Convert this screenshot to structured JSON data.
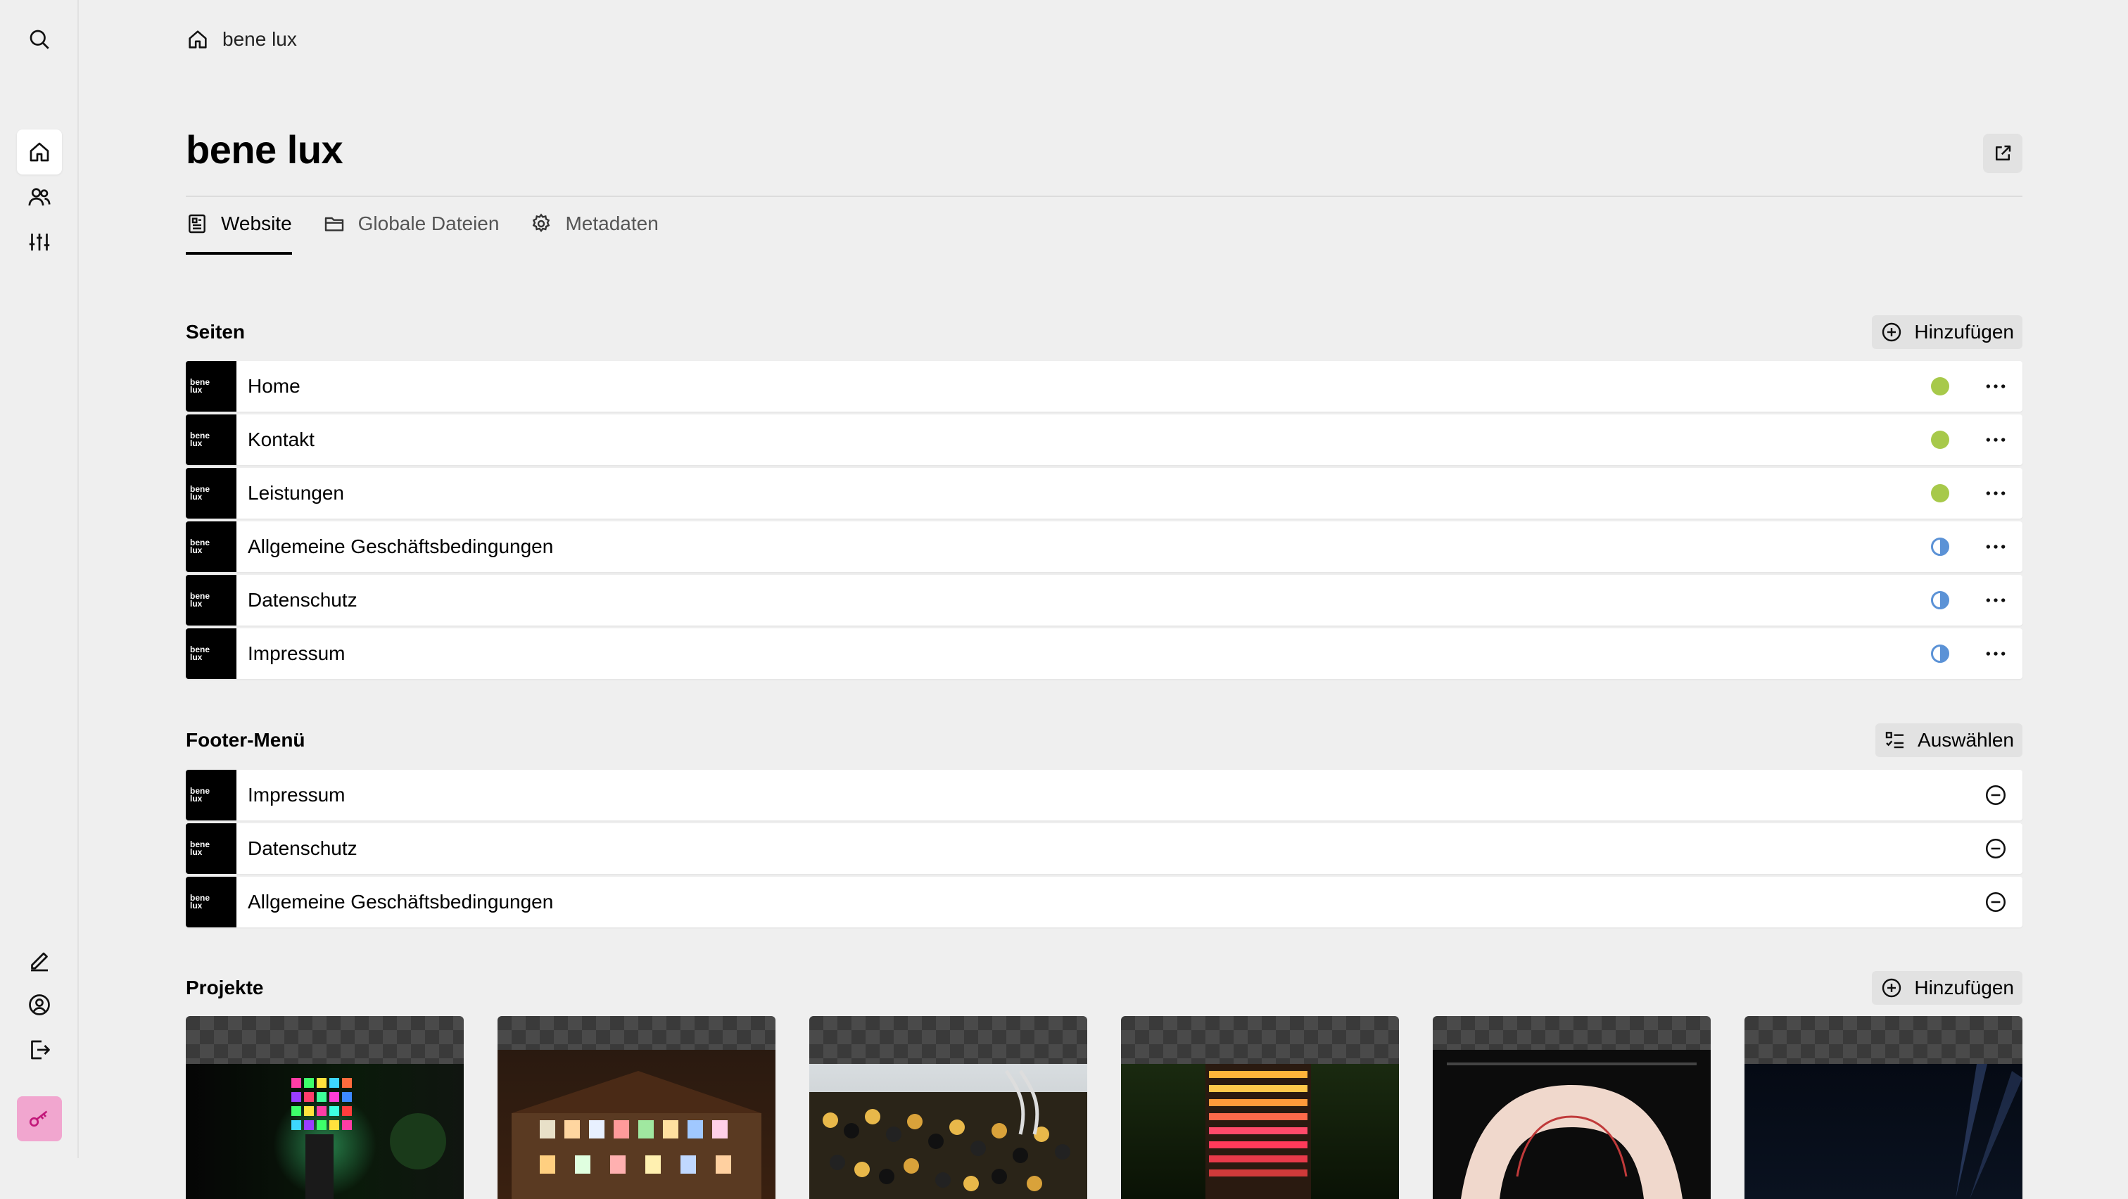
{
  "breadcrumb": {
    "home_label": "bene lux"
  },
  "page": {
    "title": "bene lux"
  },
  "tabs": [
    {
      "label": "Website",
      "icon": "document-icon",
      "active": true
    },
    {
      "label": "Globale Dateien",
      "icon": "folder-icon",
      "active": false
    },
    {
      "label": "Metadaten",
      "icon": "gear-icon",
      "active": false
    }
  ],
  "thumb_text": {
    "line1": "bene",
    "line2": "lux"
  },
  "seiten": {
    "title": "Seiten",
    "add_label": "Hinzufügen",
    "items": [
      {
        "label": "Home",
        "status": "published"
      },
      {
        "label": "Kontakt",
        "status": "published"
      },
      {
        "label": "Leistungen",
        "status": "published"
      },
      {
        "label": "Allgemeine Geschäftsbedingungen",
        "status": "draft"
      },
      {
        "label": "Datenschutz",
        "status": "draft"
      },
      {
        "label": "Impressum",
        "status": "draft"
      }
    ]
  },
  "footer_menu": {
    "title": "Footer-Menü",
    "select_label": "Auswählen",
    "items": [
      {
        "label": "Impressum"
      },
      {
        "label": "Datenschutz"
      },
      {
        "label": "Allgemeine Geschäftsbedingungen"
      }
    ]
  },
  "projekte": {
    "title": "Projekte",
    "add_label": "Hinzufügen"
  },
  "colors": {
    "published": "#a7c94a",
    "draft": "#5b92d6",
    "key_button": "#f1a6cf"
  }
}
